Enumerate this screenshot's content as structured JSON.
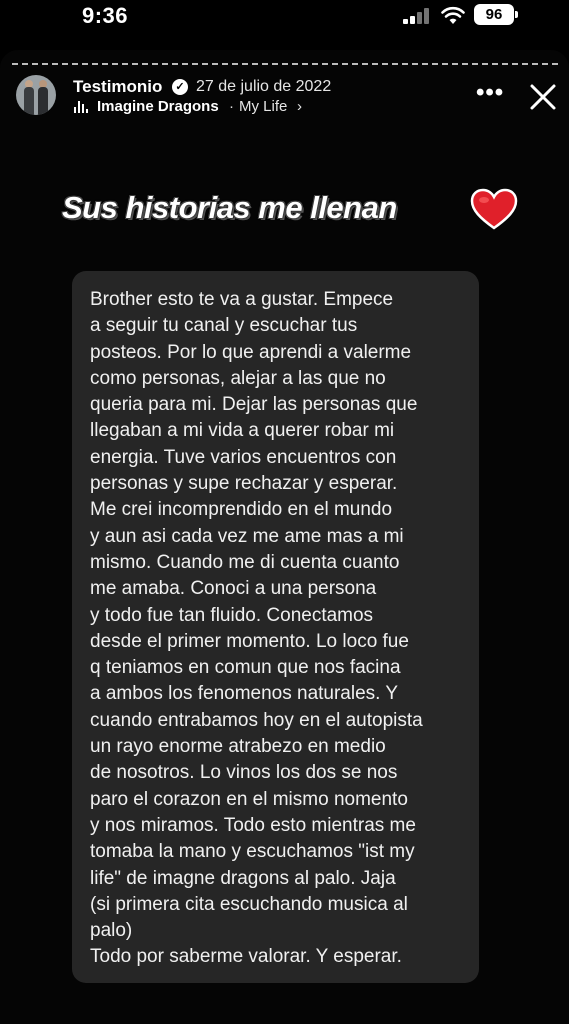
{
  "status_bar": {
    "time": "9:36",
    "battery": "96"
  },
  "story_header": {
    "username": "Testimonio",
    "date": "27 de julio de 2022",
    "music": {
      "artist": "Imagine Dragons",
      "separator": "·",
      "title": "My Life",
      "chevron": "›"
    }
  },
  "headline": "Sus historias me llenan",
  "message": "Brother esto te va a gustar. Empece\na seguir tu canal y escuchar tus\nposteos. Por lo que aprendi a valerme\ncomo personas, alejar a las que no\nqueria para mi. Dejar las personas que\nllegaban a mi vida a querer robar mi\nenergia. Tuve varios encuentros con\npersonas y supe rechazar y esperar.\nMe crei incomprendido en el mundo\ny aun asi cada vez me ame mas a mi\nmismo. Cuando me di cuenta cuanto\nme amaba. Conoci a una persona\ny todo fue tan fluido. Conectamos\ndesde el primer momento. Lo loco fue\nq teniamos en comun que nos facina\na ambos los fenomenos naturales. Y\ncuando entrabamos hoy en el autopista\nun rayo enorme atrabezo en medio\nde nosotros. Lo vinos los dos se nos\nparo el corazon en el mismo nomento\ny nos miramos. Todo esto mientras me\ntomaba la mano y escuchamos \"ist my\nlife\" de imagne dragons al palo. Jaja\n(si primera cita escuchando musica al\npalo)\nTodo por saberme valorar. Y esperar.",
  "icons": {
    "more": "more-options-icon",
    "close": "close-icon",
    "heart": "red-heart-icon",
    "verified": "verified-badge-icon",
    "music": "music-bars-icon"
  },
  "colors": {
    "background": "#000000",
    "card": "#262626",
    "heart": "#e0202a"
  }
}
